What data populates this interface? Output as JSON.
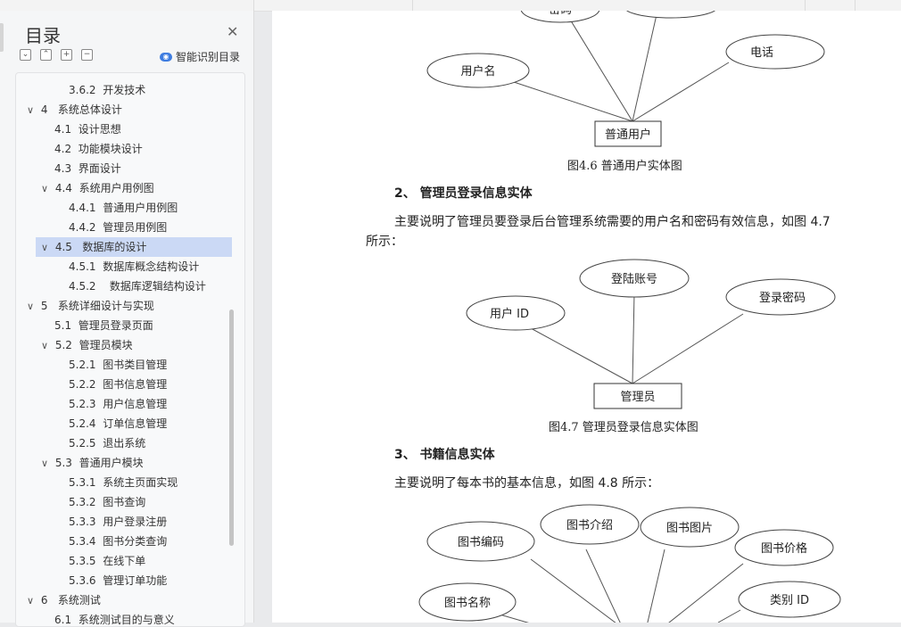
{
  "sidebar": {
    "title": "目录",
    "smart_label": "智能识别目录",
    "tools": [
      "collapse-all",
      "expand-level",
      "expand-one",
      "collapse-one"
    ],
    "items": [
      {
        "num": "3.6.2",
        "label": "开发技术"
      },
      {
        "num": "4",
        "label": "系统总体设计"
      },
      {
        "num": "4.1",
        "label": "设计思想"
      },
      {
        "num": "4.2",
        "label": "功能模块设计"
      },
      {
        "num": "4.3",
        "label": "界面设计"
      },
      {
        "num": "4.4",
        "label": "系统用户用例图"
      },
      {
        "num": "4.4.1",
        "label": "普通用户用例图"
      },
      {
        "num": "4.4.2",
        "label": "管理员用例图"
      },
      {
        "num": "4.5",
        "label": "数据库的设计"
      },
      {
        "num": "4.5.1",
        "label": "数据库概念结构设计"
      },
      {
        "num": "4.5.2",
        "label": "数据库逻辑结构设计"
      },
      {
        "num": "5",
        "label": "系统详细设计与实现"
      },
      {
        "num": "5.1",
        "label": "管理员登录页面"
      },
      {
        "num": "5.2",
        "label": "管理员模块"
      },
      {
        "num": "5.2.1",
        "label": "图书类目管理"
      },
      {
        "num": "5.2.2",
        "label": "图书信息管理"
      },
      {
        "num": "5.2.3",
        "label": "用户信息管理"
      },
      {
        "num": "5.2.4",
        "label": "订单信息管理"
      },
      {
        "num": "5.2.5",
        "label": "退出系统"
      },
      {
        "num": "5.3",
        "label": "普通用户模块"
      },
      {
        "num": "5.3.1",
        "label": "系统主页面实现"
      },
      {
        "num": "5.3.2",
        "label": "图书查询"
      },
      {
        "num": "5.3.3",
        "label": "用户登录注册"
      },
      {
        "num": "5.3.4",
        "label": "图书分类查询"
      },
      {
        "num": "5.3.5",
        "label": "在线下单"
      },
      {
        "num": "5.3.6",
        "label": "管理订单功能"
      },
      {
        "num": "6",
        "label": "系统测试"
      },
      {
        "num": "6.1",
        "label": "系统测试目的与意义"
      }
    ]
  },
  "document": {
    "fig46": {
      "entity": "普通用户",
      "attrs": [
        "密码",
        "用户名",
        "电话"
      ],
      "caption": "图4.6  普通用户实体图"
    },
    "heading2": "2、 管理员登录信息实体",
    "para2_line1": "主要说明了管理员要登录后台管理系统需要的用户名和密码有效信息，如图 4.7",
    "para2_line2": "所示：",
    "fig47": {
      "entity": "管理员",
      "attrs": [
        "用户 ID",
        "登陆账号",
        "登录密码"
      ],
      "caption": "图4.7  管理员登录信息实体图"
    },
    "heading3": "3、 书籍信息实体",
    "para3": "主要说明了每本书的基本信息，如图 4.8 所示：",
    "fig48": {
      "attrs": [
        "图书编码",
        "图书介绍",
        "图书图片",
        "图书价格",
        "图书名称",
        "类别 ID"
      ]
    }
  }
}
